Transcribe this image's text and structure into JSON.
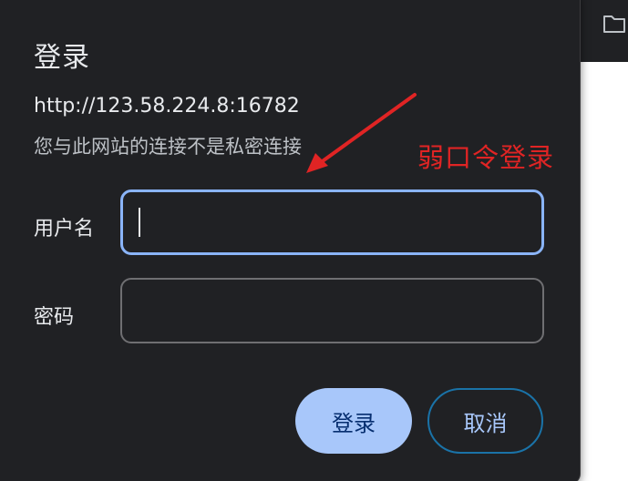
{
  "dialog": {
    "title": "登录",
    "url": "http://123.58.224.8:16782",
    "warning": "您与此网站的连接不是私密连接"
  },
  "annotation": {
    "text": "弱口令登录",
    "color": "#e02424"
  },
  "form": {
    "username_label": "用户名",
    "username_value": "",
    "password_label": "密码",
    "password_value": ""
  },
  "buttons": {
    "login_label": "登录",
    "cancel_label": "取消"
  },
  "colors": {
    "dialog_bg": "#202124",
    "focus_border": "#8ab4f8",
    "primary_button": "#a8c7fa"
  },
  "icons": {
    "toolbar_icon": "folder-icon"
  }
}
